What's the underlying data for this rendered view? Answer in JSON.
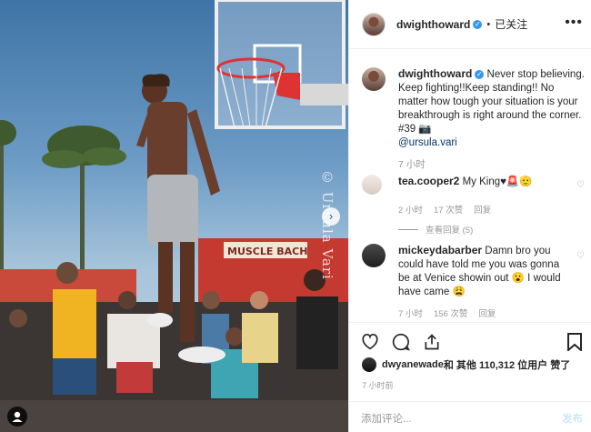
{
  "photo": {
    "watermark": "© Ursula Vari",
    "sign_text": "MUSCLE BACH",
    "next_arrow": "›"
  },
  "post_header": {
    "username": "dwighthoward",
    "follow_label": "已关注",
    "more_glyph": "•••"
  },
  "caption": {
    "username": "dwighthoward",
    "text": "Never stop believing. Keep fighting!!Keep standing!! No matter how tough your situation is your breakthrough is right around the corner. #39",
    "camera_glyph": "📷",
    "mention": "@ursula.vari",
    "time": "7 小时"
  },
  "comments": [
    {
      "username": "tea.cooper2",
      "text": "My King♥🚨🫡",
      "time": "2 小时",
      "likes": "17 次赞",
      "reply": "回复",
      "view_replies": "查看回复 (5)"
    },
    {
      "username": "mickeydabarber",
      "text": "Damn bro you could have told me you was gonna be at Venice showin out 😮 I would have came 😩",
      "time": "7 小时",
      "likes": "156 次赞",
      "reply": "回复"
    }
  ],
  "actions": {
    "liked_by_user": "dwyanewade",
    "liked_by_text": " 和 其他 110,312 位用户 赞了",
    "post_time": "7 小时前"
  },
  "add_comment": {
    "placeholder": "添加评论...",
    "post_label": "发布"
  },
  "colors": {
    "link": "#003569",
    "verified": "#3897f0",
    "post_button_disabled": "#b2dffc"
  }
}
